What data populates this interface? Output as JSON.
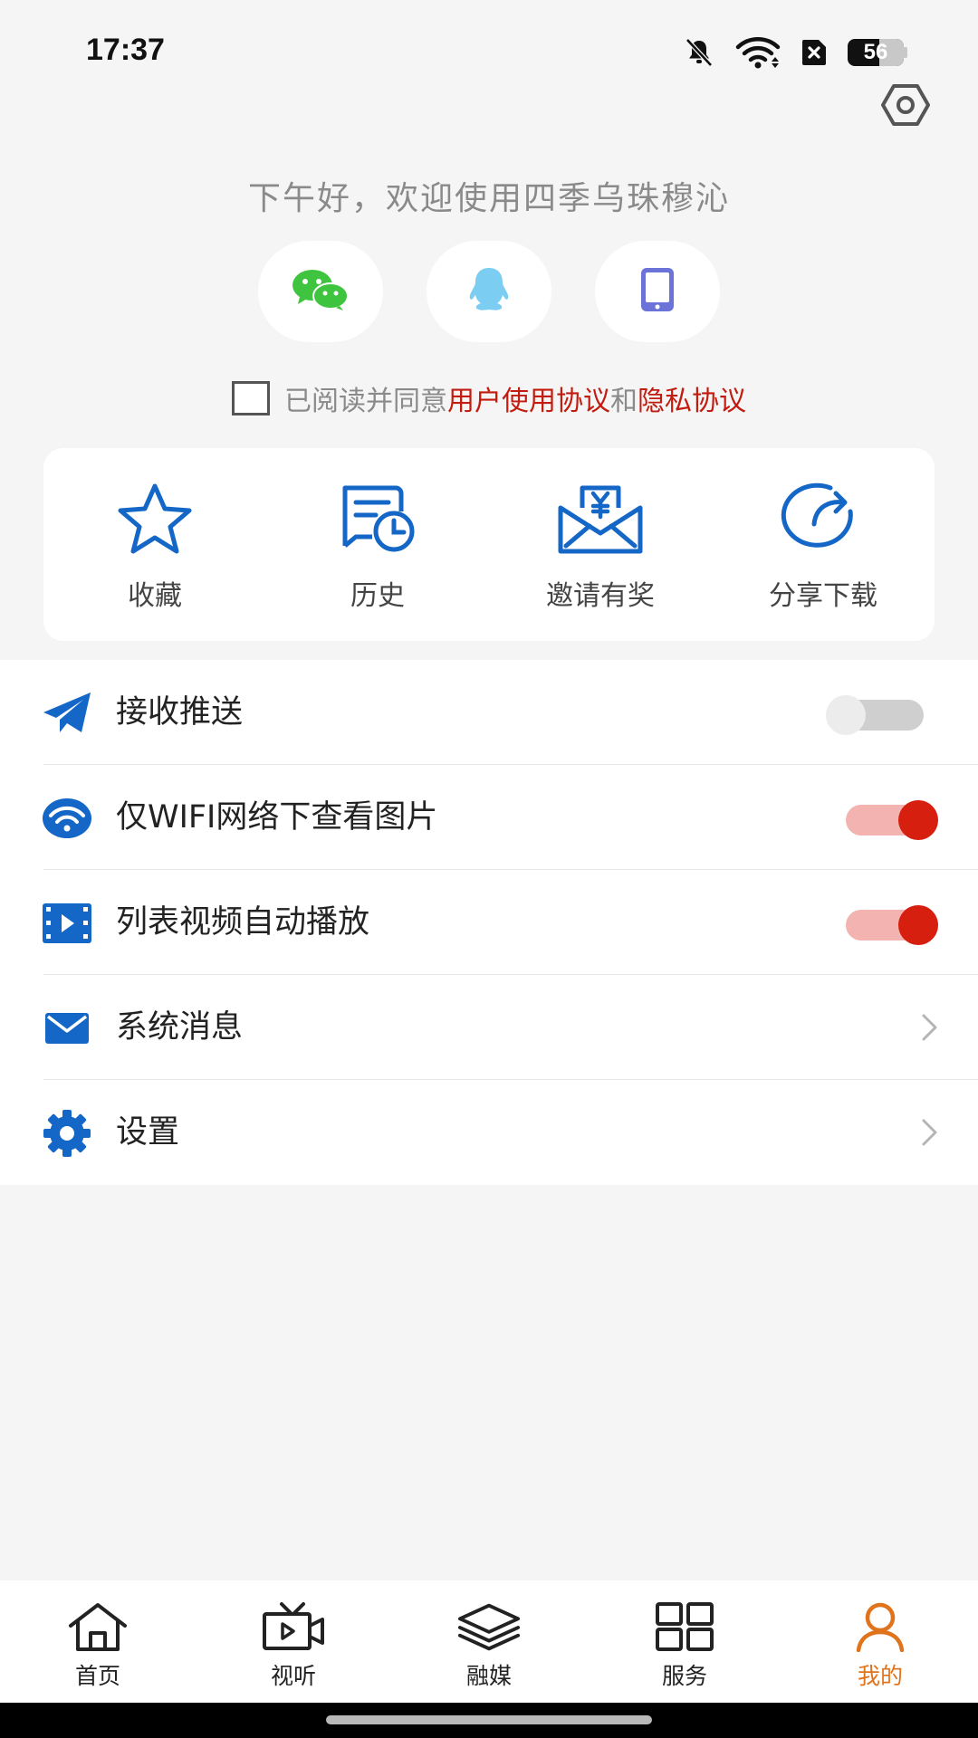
{
  "status": {
    "time": "17:37",
    "battery": "56",
    "battery_level": 0.56,
    "icons": [
      "bell-muted-icon",
      "wifi-icon",
      "sim-off-icon",
      "battery-icon"
    ]
  },
  "greeting": "下午好，欢迎使用四季乌珠穆沁",
  "login_options": [
    "wechat-icon",
    "qq-icon",
    "phone-icon"
  ],
  "agreement": {
    "prefix": "已阅读并同意",
    "user_link": "用户使用协议",
    "and": "和",
    "privacy_link": "隐私协议"
  },
  "quick_actions": [
    {
      "label": "收藏",
      "icon": "star-icon"
    },
    {
      "label": "历史",
      "icon": "history-icon"
    },
    {
      "label": "邀请有奖",
      "icon": "invite-reward-icon"
    },
    {
      "label": "分享下载",
      "icon": "share-icon"
    }
  ],
  "settings": [
    {
      "label": "接收推送",
      "icon": "paper-plane-icon",
      "type": "toggle",
      "on": false
    },
    {
      "label": "仅WIFI网络下查看图片",
      "icon": "wifi-icon",
      "type": "toggle",
      "on": true
    },
    {
      "label": "列表视频自动播放",
      "icon": "video-icon",
      "type": "toggle",
      "on": true
    },
    {
      "label": "系统消息",
      "icon": "mail-icon",
      "type": "link"
    },
    {
      "label": "设置",
      "icon": "gear-icon",
      "type": "link"
    }
  ],
  "tabs": [
    {
      "label": "首页",
      "icon": "home-icon",
      "active": false
    },
    {
      "label": "视听",
      "icon": "tv-icon",
      "active": false
    },
    {
      "label": "融媒",
      "icon": "layers-icon",
      "active": false
    },
    {
      "label": "服务",
      "icon": "grid-icon",
      "active": false
    },
    {
      "label": "我的",
      "icon": "user-icon",
      "active": true
    }
  ],
  "colors": {
    "accent_blue": "#1467c6",
    "link_red": "#c21c10",
    "toggle_on": "#d61f0f",
    "tab_active": "#e0741d",
    "wechat_green": "#3ec43e",
    "qq_blue": "#7ccdf2",
    "phone_purple": "#6b73d8"
  }
}
